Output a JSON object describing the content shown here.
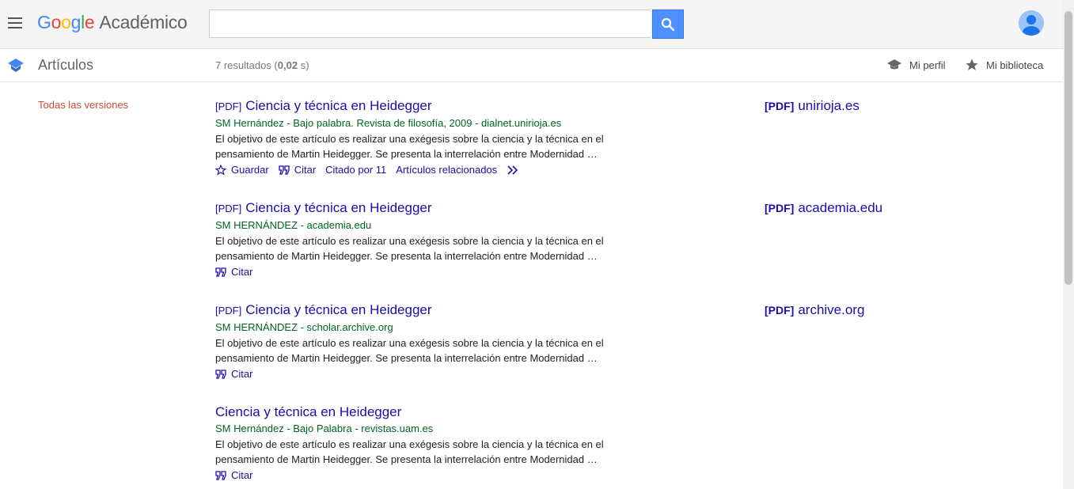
{
  "header": {
    "logo": {
      "g1": "G",
      "g2": "o",
      "g3": "o",
      "g4": "g",
      "g5": "l",
      "g6": "e",
      "suffix": "Académico"
    },
    "search": {
      "value": "",
      "placeholder": ""
    }
  },
  "subbar": {
    "section_title": "Artículos",
    "result_count_prefix": "7 resultados (",
    "result_time": "0,02",
    "result_count_suffix": " s)",
    "profile_label": "Mi perfil",
    "library_label": "Mi biblioteca"
  },
  "sidebar": {
    "versions_label": "Todas las versiones"
  },
  "results": [
    {
      "pdf_tag": "[PDF]",
      "title": "Ciencia y técnica en Heidegger",
      "meta": "SM Hernández - Bajo palabra. Revista de filosofía, 2009 - dialnet.unirioja.es",
      "snippet": "El objetivo de este artículo es realizar una exégesis sobre la ciencia y la técnica en el pensamiento de Martin Heidegger. Se presenta la interrelación entre Modernidad …",
      "save_label": "Guardar",
      "cite_label": "Citar",
      "cited_by_label": "Citado por 11",
      "related_label": "Artículos relacionados",
      "side_pdf_tag": "[PDF]",
      "side_link": "unirioja.es"
    },
    {
      "pdf_tag": "[PDF]",
      "title": "Ciencia y técnica en Heidegger",
      "meta": "SM HERNÁNDEZ - academia.edu",
      "snippet": "El objetivo de este artículo es realizar una exégesis sobre la ciencia y la técnica en el pensamiento de Martin Heidegger. Se presenta la interrelación entre Modernidad …",
      "cite_label": "Citar",
      "side_pdf_tag": "[PDF]",
      "side_link": "academia.edu"
    },
    {
      "pdf_tag": "[PDF]",
      "title": "Ciencia y técnica en Heidegger",
      "meta": "SM HERNÁNDEZ - scholar.archive.org",
      "snippet": "El objetivo de este artículo es realizar una exégesis sobre la ciencia y la técnica en el pensamiento de Martin Heidegger. Se presenta la interrelación entre Modernidad …",
      "cite_label": "Citar",
      "side_pdf_tag": "[PDF]",
      "side_link": "archive.org"
    },
    {
      "title": "Ciencia y técnica en Heidegger",
      "meta": "SM Hernández - Bajo Palabra - revistas.uam.es",
      "snippet": "El objetivo de este artículo es realizar una exégesis sobre la ciencia y la técnica en el pensamiento de Martin Heidegger. Se presenta la interrelación entre Modernidad …",
      "cite_label": "Citar"
    }
  ],
  "colors": {
    "link": "#1a0dab",
    "meta_green": "#006621",
    "versions_red": "#d14836",
    "search_button": "#4d90fe"
  }
}
